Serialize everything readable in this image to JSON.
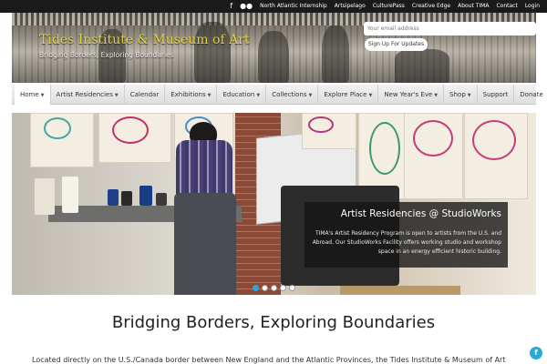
{
  "topbar": {
    "facebook_icon": "f",
    "flickr_icon": "●●",
    "links": [
      "North Atlantic Internship",
      "Artsipelago",
      "CulturePass",
      "Creative Edge",
      "About TIMA",
      "Contact",
      "Login"
    ]
  },
  "header": {
    "title": "Tides Institute & Museum of Art",
    "tagline": "Bridging Borders, Exploring Boundaries",
    "email_placeholder": "Your email address",
    "signup_label": "Sign Up For Updates"
  },
  "nav": {
    "items": [
      {
        "label": "Home",
        "dropdown": true,
        "active": true
      },
      {
        "label": "Artist Residencies",
        "dropdown": true
      },
      {
        "label": "Calendar",
        "dropdown": false
      },
      {
        "label": "Exhibitions",
        "dropdown": true
      },
      {
        "label": "Education",
        "dropdown": true
      },
      {
        "label": "Collections",
        "dropdown": true
      },
      {
        "label": "Explore Place",
        "dropdown": true
      },
      {
        "label": "New Year's Eve",
        "dropdown": true
      },
      {
        "label": "Shop",
        "dropdown": true
      },
      {
        "label": "Support",
        "dropdown": false
      },
      {
        "label": "Donate",
        "dropdown": false
      }
    ]
  },
  "slider": {
    "caption_title": "Artist Residencies @ StudioWorks",
    "caption_text": "TIMA's Artist Residency Program is open to artists from the U.S. and Abroad. Our StudioWorks Facility offers working studio and workshop space in an energy efficient historic building.",
    "slide_count": 5,
    "active_slide": 1
  },
  "main": {
    "headline": "Bridging Borders, Exploring Boundaries",
    "intro": "Located directly on the U.S./Canada border between New England and the Atlantic Provinces, the Tides Institute & Museum of Art"
  },
  "floating": {
    "facebook_label": "f"
  },
  "colors": {
    "accent": "#2aa8d8",
    "title_yellow": "#e8d23a",
    "topbar": "#1a1a1a"
  }
}
